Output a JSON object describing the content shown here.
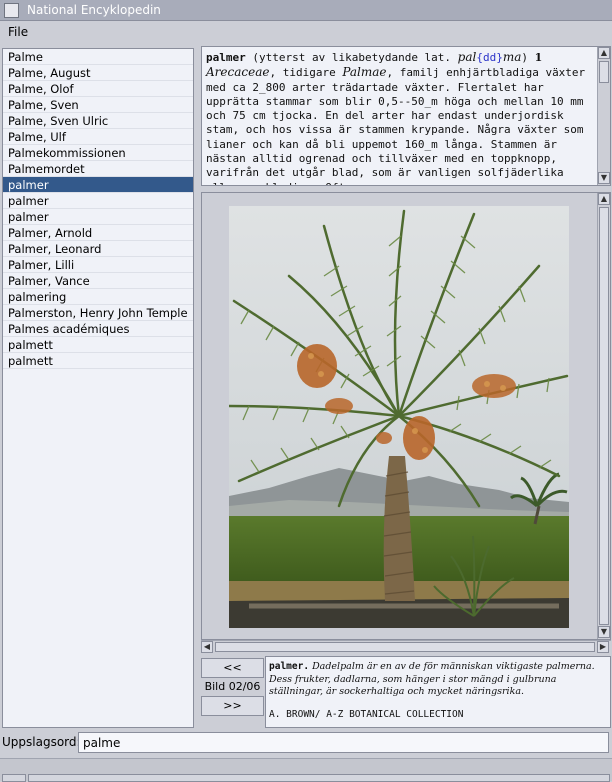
{
  "window": {
    "title": "National Encyklopedin"
  },
  "menu": {
    "file_label": "File"
  },
  "entries": [
    "Palme",
    "Palme, August",
    "Palme, Olof",
    "Palme, Sven",
    "Palme, Sven Ulric",
    "Palme, Ulf",
    "Palmekommissionen",
    "Palmemordet",
    "palmer",
    "palmer",
    "palmer",
    "Palmer, Arnold",
    "Palmer, Leonard",
    "Palmer, Lilli",
    "Palmer, Vance",
    "palmering",
    "Palmerston, Henry John Temple",
    "Palmes académiques",
    "palmett",
    "palmett"
  ],
  "selected_index": 8,
  "article": {
    "headword": "palmer",
    "etym_pre": " (ytterst av likabetydande lat. ",
    "etym_word_a": "pal",
    "etym_blue": "{dd}",
    "etym_word_b": "ma",
    "etym_post": ") ",
    "sense_number": "1",
    "family_name": "Arecaceae",
    "mid_text": ", tidigare ",
    "old_family_name": "Palmae",
    "body_text": ", familj enhjärtbladiga växter med ca 2_800 arter trädartade växter. Flertalet har upprätta stammar som blir 0,5--50_m höga och mellan 10 mm och 75 cm tjocka. En del arter har endast underjordisk stam, och hos vissa är stammen krypande. Några växter som lianer och kan då bli uppemot 160_m långa. Stammen är nästan alltid ogrenad och tillväxer med en toppknopp, varifrån det utgår blad, som är vanligen solfjäderlika eller parbladiga. Ofta ..."
  },
  "image_nav": {
    "prev_label": "<<",
    "counter": "Bild 02/06",
    "next_label": ">>"
  },
  "caption": {
    "headword": "palmer.",
    "text": " Dadelpalm är en av de för människan viktigaste palmerna. Dess frukter, dadlarna, som hänger i stor mängd i gulbruna ställningar, är sockerhaltiga och mycket näringsrika.",
    "credit": "A. BROWN/ A-Z BOTANICAL COLLECTION"
  },
  "search": {
    "label": "Uppslagsord:",
    "value": "palme"
  },
  "colors": {
    "selection": "#33598b",
    "link_blue": "#2b33c9",
    "panel_bg": "#f0f2f8",
    "chrome": "#ccced6"
  }
}
